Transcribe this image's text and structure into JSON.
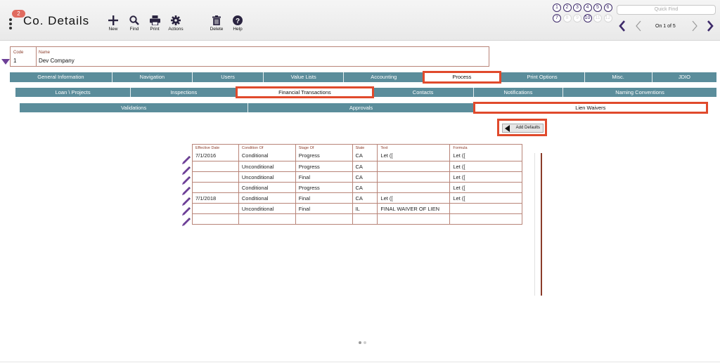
{
  "header": {
    "badge": "2",
    "title": "Co. Details",
    "toolbar": [
      {
        "label": "New",
        "icon": "plus-icon"
      },
      {
        "label": "Find",
        "icon": "search-icon"
      },
      {
        "label": "Print",
        "icon": "printer-icon"
      },
      {
        "label": "Actions",
        "icon": "gear-icon"
      },
      {
        "label": "Delete",
        "icon": "trash-icon"
      },
      {
        "label": "Help",
        "icon": "help-icon"
      }
    ],
    "records": [
      "1",
      "2",
      "3",
      "4",
      "5",
      "6",
      "7",
      "8",
      "9",
      "10",
      "11",
      "12"
    ],
    "quick_find_placeholder": "Quick Find",
    "record_position": "On 1 of 5"
  },
  "record": {
    "code_label": "Code",
    "code_value": "1",
    "name_label": "Name",
    "name_value": "Dev Company"
  },
  "tabs_level1": [
    "General Information",
    "Navigation",
    "Users",
    "Value Lists",
    "Accounting",
    "Process",
    "Print Options",
    "Misc.",
    "JDIO"
  ],
  "tabs_level2": [
    "Loan \\ Projects",
    "Inspections",
    "Financial Transactions",
    "Contacts",
    "Notifications",
    "Naming Conventions"
  ],
  "tabs_level3": [
    "Validations",
    "Approvals",
    "Lien Waivers"
  ],
  "add_defaults_label": "Add Defaults",
  "table": {
    "headers": [
      "Effective Date",
      "Condition Of",
      "Stage Of",
      "State",
      "Text",
      "Formula"
    ],
    "rows": [
      [
        "7/1/2016",
        "Conditional",
        "Progress",
        "CA",
        "Let ([",
        "Let (["
      ],
      [
        "",
        "Unconditional",
        "Progress",
        "CA",
        "",
        "Let (["
      ],
      [
        "",
        "Unconditional",
        "Final",
        "CA",
        "",
        "Let (["
      ],
      [
        "",
        "Conditional",
        "Progress",
        "CA",
        "",
        "Let (["
      ],
      [
        "7/1/2018",
        "Conditional",
        "Final",
        "CA",
        "Let ([",
        "Let (["
      ],
      [
        "",
        "Unconditional",
        "Final",
        "IL",
        "FINAL WAIVER OF LIEN",
        ""
      ],
      [
        "",
        "",
        "",
        "",
        "",
        ""
      ]
    ]
  },
  "colors": {
    "tab_bg": "#5b8d9b",
    "highlight": "#e04a2c",
    "border": "#b88478",
    "accent": "#6d3f97"
  }
}
